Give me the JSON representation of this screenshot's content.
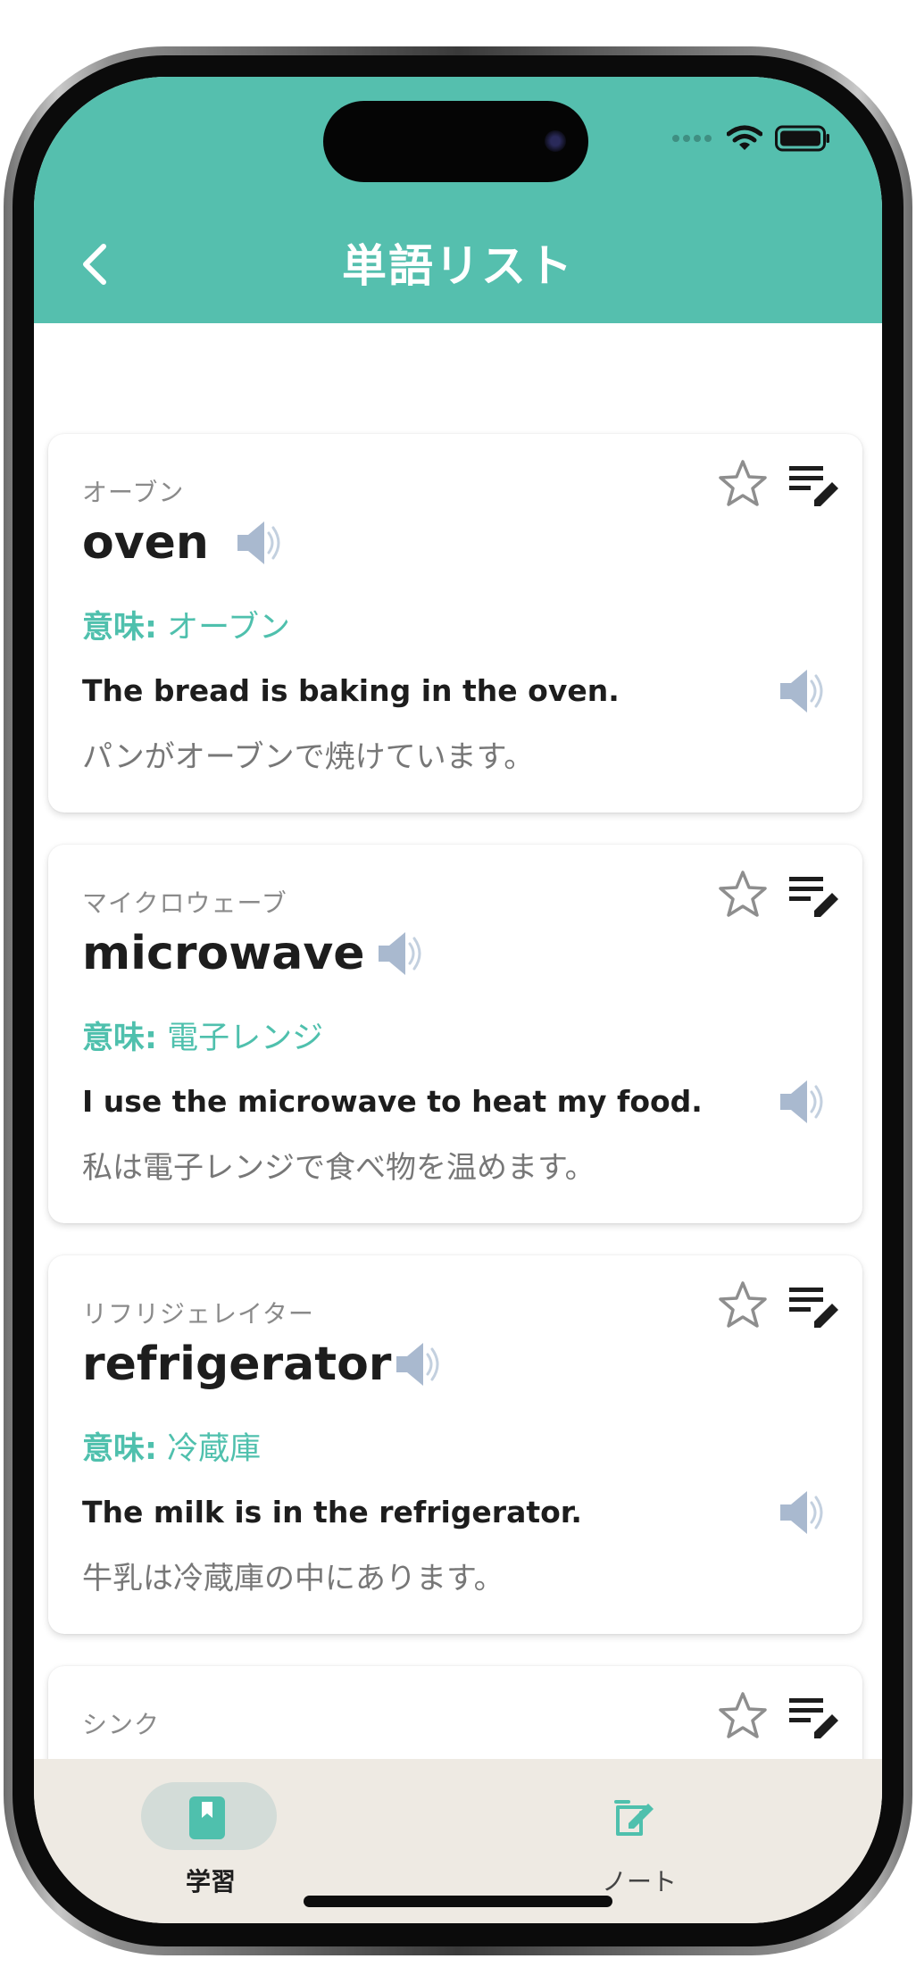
{
  "status_bar": {},
  "header": {
    "title": "単語リスト"
  },
  "words": [
    {
      "kana": "オーブン",
      "word": "oven",
      "meaning_label": "意味:",
      "meaning": "オーブン",
      "example_en": "The bread is baking in the oven.",
      "example_ja": "パンがオーブンで焼けています。"
    },
    {
      "kana": "マイクロウェーブ",
      "word": "microwave",
      "meaning_label": "意味:",
      "meaning": "電子レンジ",
      "example_en": "I use the microwave to heat my food.",
      "example_ja": "私は電子レンジで食べ物を温めます。"
    },
    {
      "kana": "リフリジェレイター",
      "word": "refrigerator",
      "meaning_label": "意味:",
      "meaning": "冷蔵庫",
      "example_en": "The milk is in the refrigerator.",
      "example_ja": "牛乳は冷蔵庫の中にあります。"
    },
    {
      "kana": "シンク"
    }
  ],
  "tabs": [
    {
      "label": "学習",
      "icon": "book-icon",
      "active": true
    },
    {
      "label": "ノート",
      "icon": "note-edit-icon",
      "active": false
    }
  ],
  "colors": {
    "accent": "#55bfae",
    "meaning_text": "#4fc0ad",
    "tab_bar_bg": "#eeeae3",
    "active_tab_pill": "#d3dcd8",
    "audio_icon": "#a9b9cf"
  }
}
